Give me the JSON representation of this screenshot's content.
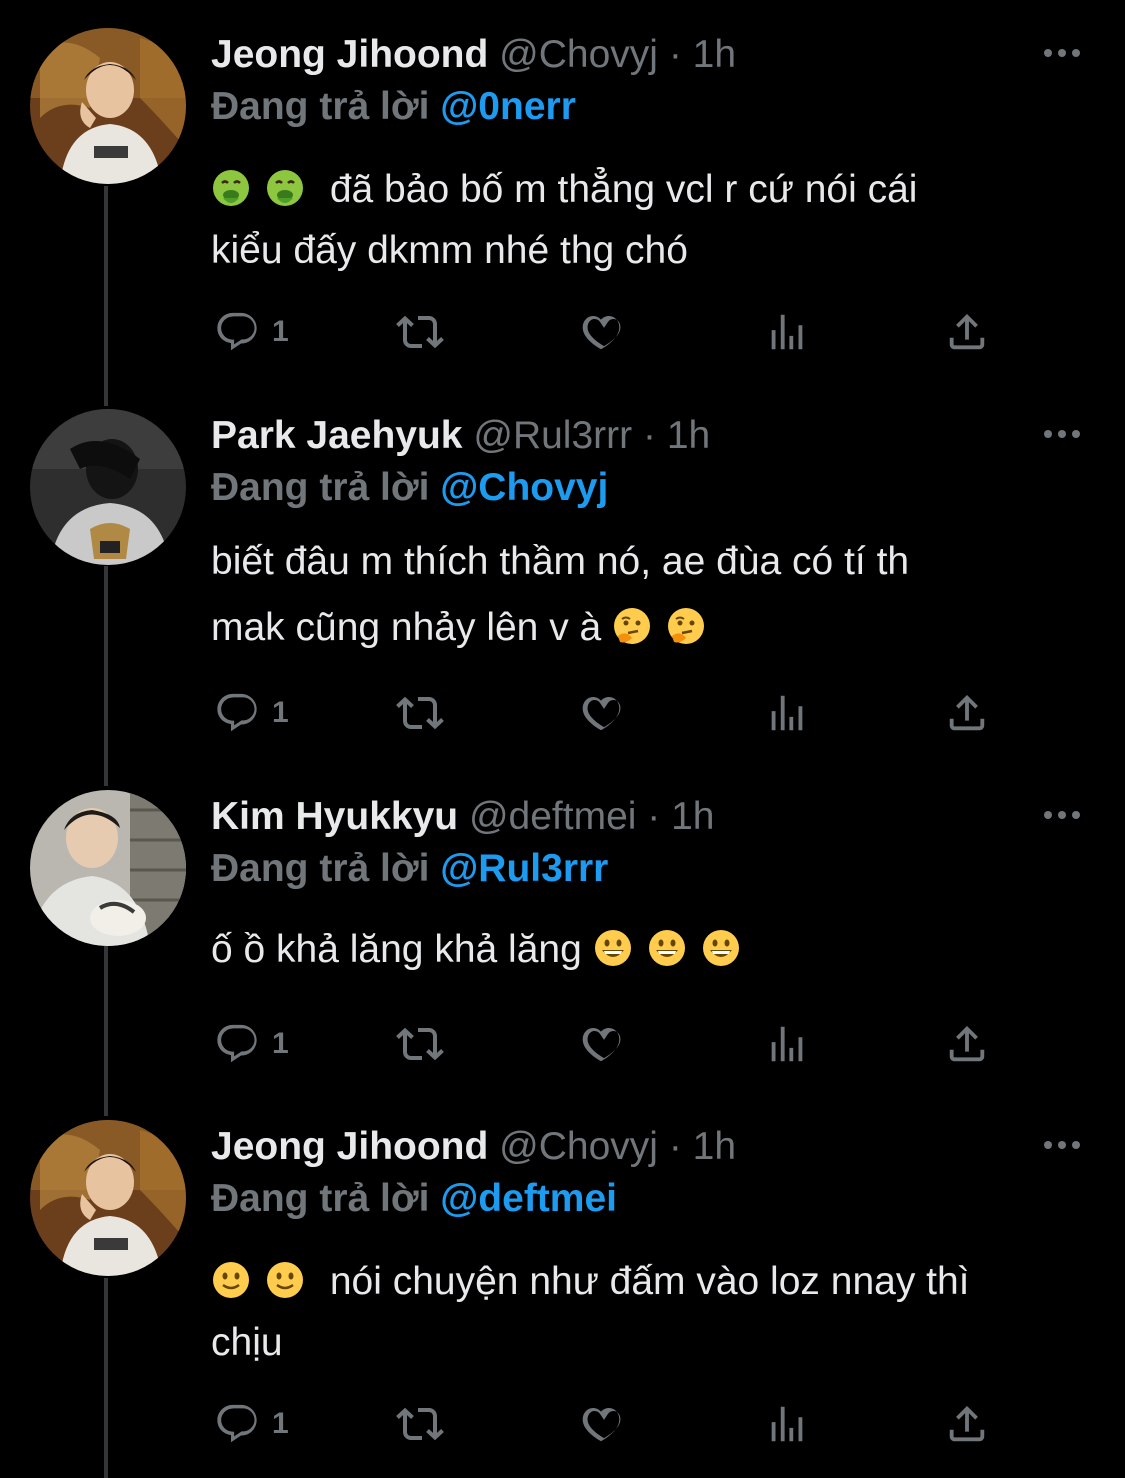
{
  "tweets": [
    {
      "name": "Jeong Jihoond",
      "handle": "@Chovyj",
      "separator": "·",
      "time": "1h",
      "reply_label": "Đang trả lời",
      "reply_mention": "@0nerr",
      "emojis": [
        "nauseated-face",
        "nauseated-face"
      ],
      "text": "đã bảo bố m thẳng vcl r cứ nói cái",
      "text2": "kiểu đấy dkmm nhé thg chó",
      "reply_count": "1"
    },
    {
      "name": "Park Jaehyuk",
      "handle": "@Rul3rrr",
      "separator": "·",
      "time": "1h",
      "reply_label": "Đang trả lời",
      "reply_mention": "@Chovyj",
      "text": "biết đâu m thích thầm nó, ae đùa có tí th",
      "text2": "mak cũng nhảy lên v à",
      "emojis_trailing": [
        "thinking-face",
        "thinking-face"
      ],
      "reply_count": "1"
    },
    {
      "name": "Kim Hyukkyu",
      "handle": "@deftmei",
      "separator": "·",
      "time": "1h",
      "reply_label": "Đang trả lời",
      "reply_mention": "@Rul3rrr",
      "text": "ố ồ khả lăng khả lăng",
      "emojis_trailing": [
        "grinning-face",
        "grinning-face",
        "grinning-face"
      ],
      "reply_count": "1"
    },
    {
      "name": "Jeong Jihoond",
      "handle": "@Chovyj",
      "separator": "·",
      "time": "1h",
      "reply_label": "Đang trả lời",
      "reply_mention": "@deftmei",
      "emojis": [
        "slightly-smiling-face",
        "slightly-smiling-face"
      ],
      "text": "nói chuyện như đấm vào loz nnay thì",
      "text2": "chịu",
      "reply_count": "1"
    }
  ],
  "colors": {
    "background": "#000000",
    "primary_text": "#e7e9ea",
    "secondary_text": "#71767b",
    "accent": "#1d9bf0",
    "thread_line": "#333639"
  }
}
